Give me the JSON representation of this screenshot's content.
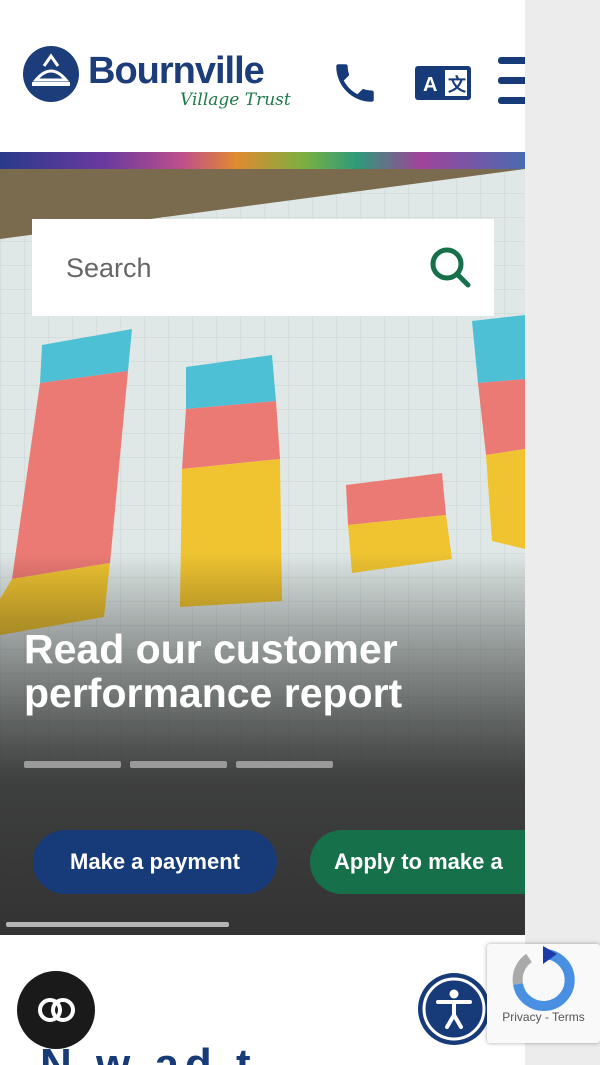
{
  "header": {
    "logo_text": "Bournville",
    "logo_sub": "Village Trust",
    "icons": {
      "phone": "phone-icon",
      "translate": "translate-icon",
      "menu": "hamburger-menu-icon"
    }
  },
  "search": {
    "placeholder": "Search",
    "icon": "search-icon"
  },
  "hero": {
    "headline_line1": "Read our customer",
    "headline_line2": "performance report",
    "slide_count": 3
  },
  "actions": {
    "pay_label": "Make a payment",
    "apply_label": "Apply to make a"
  },
  "below": {
    "title_fragment": "N  w  ad  t"
  },
  "cookie": {
    "icon": "cookie-consent-icon"
  },
  "accessibility": {
    "icon": "accessibility-icon"
  },
  "recaptcha": {
    "text": "Privacy - Terms"
  },
  "colors": {
    "navy": "#173b78",
    "green": "#16704a",
    "white": "#ffffff"
  }
}
